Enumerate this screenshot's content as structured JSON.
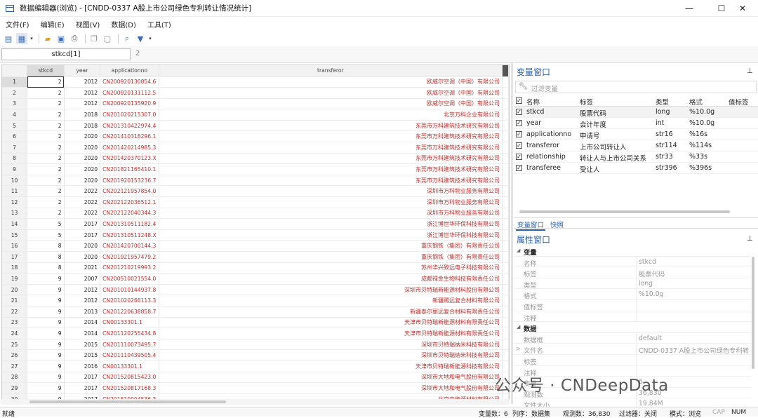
{
  "window": {
    "title": "数据编辑器(浏览) - [CNDD-0337 A股上市公司绿色专利转让情况统计]",
    "minimize": "—",
    "maximize": "☐",
    "close": "✕"
  },
  "menu": [
    "文件(F)",
    "编辑(E)",
    "视图(V)",
    "数据(D)",
    "工具(T)"
  ],
  "toolbar_icons": [
    "table-icon",
    "edit-mode-icon",
    "open-icon",
    "save-icon",
    "print-icon",
    "copy-icon",
    "paste-icon",
    "find-icon",
    "filter-icon"
  ],
  "cellbar": {
    "name": "stkcd[1]",
    "value": "2"
  },
  "grid": {
    "columns": [
      "stkcd",
      "year",
      "applicationno",
      "transferor"
    ],
    "rows": [
      {
        "n": "1",
        "stkcd": "2",
        "year": "2012",
        "app": "CN200920130854.6",
        "tr": "欧威尔空调（中国）有限公司"
      },
      {
        "n": "2",
        "stkcd": "2",
        "year": "2012",
        "app": "CN200920131112.5",
        "tr": "欧威尔空调（中国）有限公司"
      },
      {
        "n": "3",
        "stkcd": "2",
        "year": "2012",
        "app": "CN200920135920.9",
        "tr": "欧威尔空调（中国）有限公司"
      },
      {
        "n": "4",
        "stkcd": "2",
        "year": "2018",
        "app": "CN201020215307.0",
        "tr": "北京万科企业有限公司"
      },
      {
        "n": "5",
        "stkcd": "2",
        "year": "2018",
        "app": "CN201310422974.4",
        "tr": "东莞市万科建筑技术研究有限公司"
      },
      {
        "n": "6",
        "stkcd": "2",
        "year": "2020",
        "app": "CN201410318296.1",
        "tr": "东莞市万科建筑技术研究有限公司"
      },
      {
        "n": "7",
        "stkcd": "2",
        "year": "2020",
        "app": "CN201420214985.3",
        "tr": "东莞市万科建筑技术研究有限公司"
      },
      {
        "n": "8",
        "stkcd": "2",
        "year": "2020",
        "app": "CN201420370123.X",
        "tr": "东莞市万科建筑技术研究有限公司"
      },
      {
        "n": "9",
        "stkcd": "2",
        "year": "2020",
        "app": "CN201821165410.1",
        "tr": "东莞市万科建筑技术研究有限公司"
      },
      {
        "n": "10",
        "stkcd": "2",
        "year": "2020",
        "app": "CN201920153236.7",
        "tr": "东莞市万科建筑技术研究有限公司"
      },
      {
        "n": "11",
        "stkcd": "2",
        "year": "2022",
        "app": "CN202121957854.0",
        "tr": "深圳市万科物业服务有限公司"
      },
      {
        "n": "12",
        "stkcd": "2",
        "year": "2022",
        "app": "CN202122036512.1",
        "tr": "深圳市万科物业服务有限公司"
      },
      {
        "n": "13",
        "stkcd": "2",
        "year": "2022",
        "app": "CN202122040344.3",
        "tr": "深圳市万科物业服务有限公司"
      },
      {
        "n": "14",
        "stkcd": "5",
        "year": "2017",
        "app": "CN201310511182.4",
        "tr": "浙江博世华环保科技有限公司"
      },
      {
        "n": "15",
        "stkcd": "5",
        "year": "2017",
        "app": "CN201310511248.X",
        "tr": "浙江博世华环保科技有限公司"
      },
      {
        "n": "16",
        "stkcd": "8",
        "year": "2020",
        "app": "CN201420700144.3",
        "tr": "重庆钢铁（集团）有限责任公司"
      },
      {
        "n": "17",
        "stkcd": "8",
        "year": "2020",
        "app": "CN201921957479.2",
        "tr": "重庆钢铁（集团）有限责任公司"
      },
      {
        "n": "18",
        "stkcd": "8",
        "year": "2021",
        "app": "CN201210219993.2",
        "tr": "苏州华兴致远电子科技有限公司"
      },
      {
        "n": "19",
        "stkcd": "9",
        "year": "2007",
        "app": "CN200510021554.0",
        "tr": "成都禄金生物科技有限责任公司"
      },
      {
        "n": "20",
        "stkcd": "9",
        "year": "2012",
        "app": "CN201010144937.8",
        "tr": "深圳市贝特瑞新能源材料股份有限公司"
      },
      {
        "n": "21",
        "stkcd": "9",
        "year": "2012",
        "app": "CN201020266113.3",
        "tr": "新疆赐远复合材料有限公司"
      },
      {
        "n": "22",
        "stkcd": "9",
        "year": "2013",
        "app": "CN201220638858.7",
        "tr": "新疆泰尔丽远复合材料有限责任公司"
      },
      {
        "n": "23",
        "stkcd": "9",
        "year": "2014",
        "app": "CN00133301.1",
        "tr": "天津市贝特瑞新能源材料有限责任公司"
      },
      {
        "n": "24",
        "stkcd": "9",
        "year": "2014",
        "app": "CN201120255434.8",
        "tr": "天津市贝特瑞新能源材料有限责任公司"
      },
      {
        "n": "25",
        "stkcd": "9",
        "year": "2015",
        "app": "CN201110073495.7",
        "tr": "深圳市贝特瑞纳米科技有限公司"
      },
      {
        "n": "26",
        "stkcd": "9",
        "year": "2015",
        "app": "CN201110439505.4",
        "tr": "深圳市贝特瑞纳米科技有限公司"
      },
      {
        "n": "27",
        "stkcd": "9",
        "year": "2016",
        "app": "CN00133301.1",
        "tr": "天津市贝特瑞新能源科技有限公司"
      },
      {
        "n": "28",
        "stkcd": "9",
        "year": "2017",
        "app": "CN201520815423.0",
        "tr": "深圳市大地和电气股份有限公司"
      },
      {
        "n": "29",
        "stkcd": "9",
        "year": "2017",
        "app": "CN201520817168.3",
        "tr": "深圳市大地和电气股份有限公司"
      },
      {
        "n": "30",
        "stkcd": "9",
        "year": "2017",
        "app": "CN201510004536.3",
        "tr": "北京中能源材料有限公司"
      }
    ]
  },
  "variables_pane": {
    "title": "变量窗口",
    "filter_placeholder": "过滤变量",
    "headers": [
      "名称",
      "标签",
      "类型",
      "格式",
      "值标签"
    ],
    "items": [
      {
        "name": "stkcd",
        "label": "股票代码",
        "type": "long",
        "format": "%10.0g"
      },
      {
        "name": "year",
        "label": "会计年度",
        "type": "int",
        "format": "%10.0g"
      },
      {
        "name": "applicationno",
        "label": "申请号",
        "type": "str16",
        "format": "%16s"
      },
      {
        "name": "transferor",
        "label": "上市公司转让人",
        "type": "str114",
        "format": "%114s"
      },
      {
        "name": "relationship",
        "label": "转让人与上市公司关系",
        "type": "str33",
        "format": "%33s"
      },
      {
        "name": "transferee",
        "label": "受让人",
        "type": "str396",
        "format": "%396s"
      }
    ],
    "tabs": [
      "变量窗口",
      "快照"
    ]
  },
  "properties_pane": {
    "title": "属性窗口",
    "sections": [
      {
        "title": "变量",
        "rows": [
          [
            "名称",
            "stkcd"
          ],
          [
            "标签",
            "股票代码"
          ],
          [
            "类型",
            "long"
          ],
          [
            "格式",
            "%10.0g"
          ],
          [
            "值标签",
            ""
          ],
          [
            "注释",
            ""
          ]
        ]
      },
      {
        "title": "数据",
        "rows": [
          [
            "数据框",
            "default"
          ],
          [
            "文件名",
            "CNDD-0337 A股上市公司绿色专利转"
          ],
          [
            "标签",
            ""
          ],
          [
            "注释",
            ""
          ],
          [
            "变量",
            "6"
          ],
          [
            "观测数",
            "36,830"
          ],
          [
            "文件大小",
            "19.84M"
          ]
        ]
      }
    ]
  },
  "watermark": "公众号 · CNDeepData",
  "statusbar": {
    "ready": "就绪",
    "vars": "变量数：6",
    "order": "列序：数据集",
    "obs": "观测数：36,830",
    "filter": "过滤器：关闭",
    "mode": "模式：浏览",
    "cap": "CAP",
    "num": "NUM"
  }
}
